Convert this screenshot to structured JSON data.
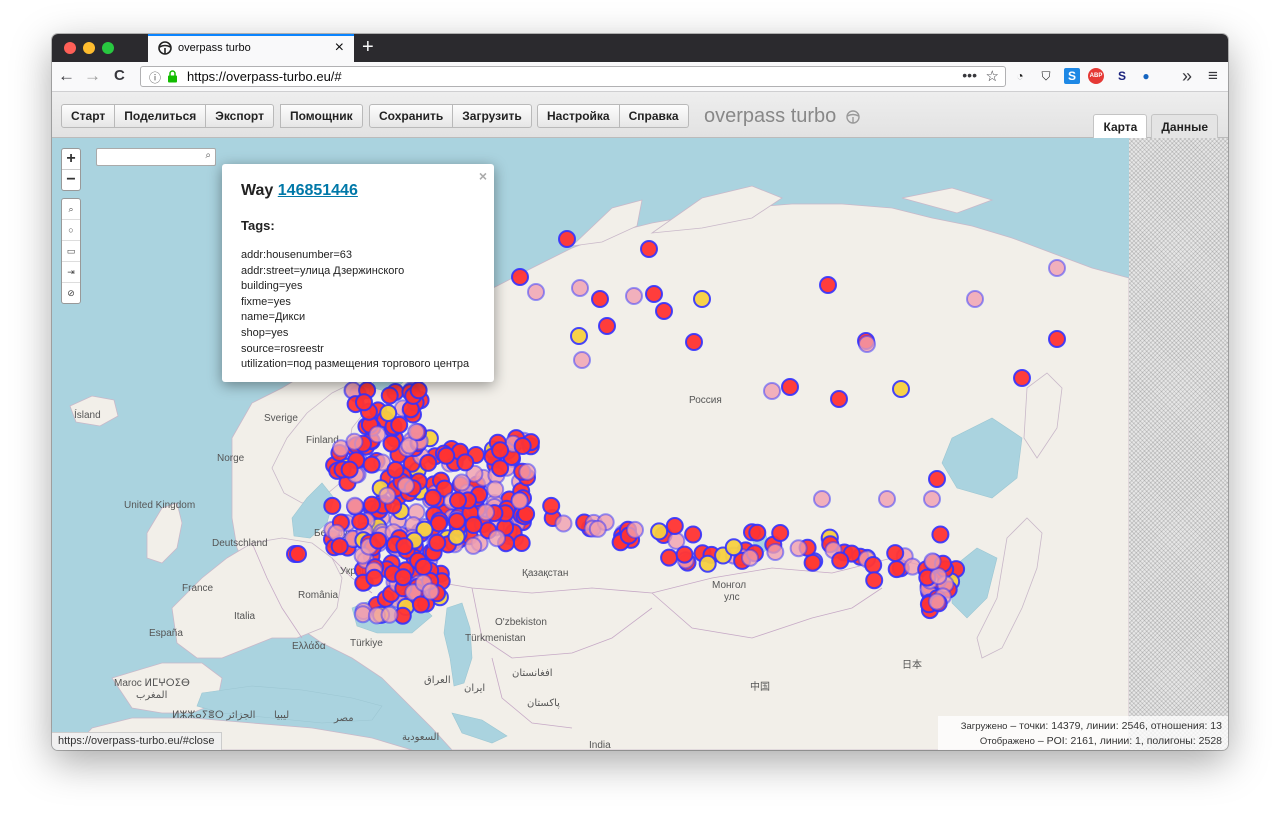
{
  "browser": {
    "tab_title": "overpass turbo",
    "tab_close": "×",
    "new_tab": "+",
    "url_host": "https://overpass-turbo.eu/",
    "url_path": "#",
    "nav_back": "←",
    "nav_forward": "→",
    "nav_reload": "C",
    "page_actions": "•••",
    "bookmark": "☆",
    "extensions": [
      {
        "name": "extension-drop-icon",
        "glyph": "◔",
        "color": "#222222"
      },
      {
        "name": "extension-shield-icon",
        "glyph": "⛉",
        "color": "#222222"
      },
      {
        "name": "extension-s-blue-icon",
        "glyph": "S",
        "color": "#1e88e5"
      },
      {
        "name": "extension-abp-icon",
        "glyph": "ABP",
        "color": "#e53935"
      },
      {
        "name": "extension-s-dark-icon",
        "glyph": "S",
        "color": "#1a237e"
      },
      {
        "name": "extension-circle-icon",
        "glyph": "●",
        "color": "#1565c0"
      }
    ],
    "overflow": "»",
    "menu": "≡"
  },
  "toolbar": {
    "group1": [
      "Старт",
      "Поделиться",
      "Экспорт"
    ],
    "group2": [
      "Помощник"
    ],
    "group3": [
      "Сохранить",
      "Загрузить"
    ],
    "group4": [
      "Настройка",
      "Справка"
    ],
    "brand": "overpass turbo",
    "view_tabs": [
      "Карта",
      "Данные"
    ]
  },
  "map": {
    "zoom_in": "+",
    "zoom_out": "−",
    "tools": [
      "⌕",
      "○",
      "▭",
      "⇥",
      "⊘"
    ],
    "search_placeholder": "",
    "labels": {
      "island": "Ísland",
      "sverige": "Sverige",
      "norge": "Norge",
      "finland": "Finland",
      "uk": "United Kingdom",
      "deutschland": "Deutschland",
      "belarus": "Беларусь",
      "ukraina": "Україна",
      "france": "France",
      "romania": "România",
      "italia": "Italia",
      "espana": "España",
      "ellada": "Ελλάδα",
      "turkiye": "Türkiye",
      "turkmenistan": "Türkmenistan",
      "uzbekiston": "O'zbekiston",
      "kazakhstan": "Қазақстан",
      "rossiya": "Россия",
      "mongol": "Монгол",
      "mongol2": "улс",
      "china": "中国",
      "japan": "日本",
      "iraq": "العراق",
      "iran": "ایران",
      "afghanistan": "افغانستان",
      "pakistan": "پاکستان",
      "misr": "مصر",
      "libya": "ليبيا",
      "algeria": "ⵍⵣⵣⴰⵢⴻⵔ الجزائر",
      "maroc": "Maroc ⵍⵎⵖⵔⵉⴱ",
      "maroc2": "المغرب",
      "saudi": "السعودية",
      "india": "India"
    }
  },
  "popup": {
    "close": "×",
    "type": "Way",
    "id": "146851446",
    "tags_heading": "Tags:",
    "tags": [
      "addr:housenumber=63",
      "addr:street=улица Дзержинского",
      "building=yes",
      "fixme=yes",
      "name=Дикси",
      "shop=yes",
      "source=rosreestr",
      "utilization=под размещения торгового центра"
    ]
  },
  "stats": {
    "loaded_label": "Загружено",
    "loaded_value": "– точки: 14379, линии: 2546, отношения: 13",
    "shown_label": "Отображено",
    "shown_value": "– POI: 2161, линии: 1, полигоны: 2528"
  },
  "status_url": "https://overpass-turbo.eu/#close",
  "colors": {
    "marker_fill": "#ff3333",
    "marker_stroke": "#3333ff",
    "marker_faded": "#f0a0b0",
    "marker_yellow": "#f7d040",
    "water": "#aad3df",
    "land": "#f2efe9"
  }
}
